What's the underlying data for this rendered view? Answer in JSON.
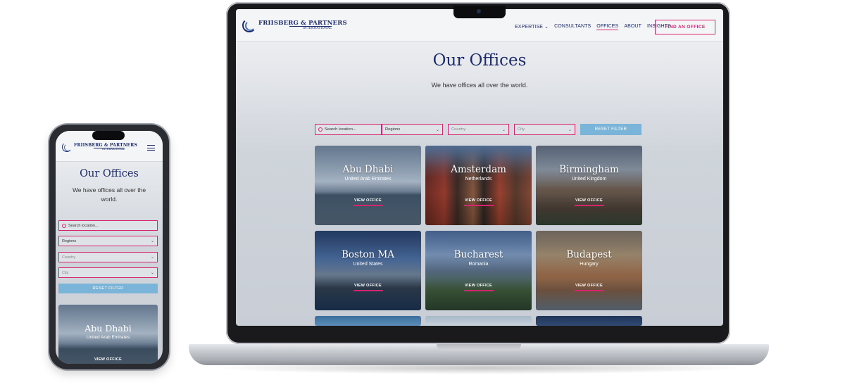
{
  "brand": {
    "name": "FRIISBERG & PARTNERS",
    "tagline": "INTERNATIONAL"
  },
  "nav": {
    "items": [
      "EXPERTISE",
      "CONSULTANTS",
      "OFFICES",
      "ABOUT",
      "INSIGHTS"
    ],
    "expertise_chevron": "⌄",
    "cta": "FIND AN OFFICE"
  },
  "page": {
    "title": "Our Offices",
    "subtitle": "We have offices all over the world."
  },
  "filters": {
    "search_placeholder": "Search location...",
    "regions": "Regions",
    "country": "Country",
    "city": "City",
    "reset": "RESET FILTER"
  },
  "offices": [
    {
      "name": "Abu Dhabi",
      "country": "United Arab Emirates",
      "button": "VIEW OFFICE"
    },
    {
      "name": "Amsterdam",
      "country": "Netherlands",
      "button": "VIEW OFFICE"
    },
    {
      "name": "Birmingham",
      "country": "United Kingdom",
      "button": "VIEW OFFICE"
    },
    {
      "name": "Boston MA",
      "country": "United States",
      "button": "VIEW OFFICE"
    },
    {
      "name": "Bucharest",
      "country": "Romania",
      "button": "VIEW OFFICE"
    },
    {
      "name": "Budapest",
      "country": "Hungary",
      "button": "VIEW OFFICE"
    }
  ],
  "colors": {
    "brand_navy": "#1d2b6b",
    "accent_pink": "#d6246e",
    "reset_blue": "#7ab4d8"
  }
}
